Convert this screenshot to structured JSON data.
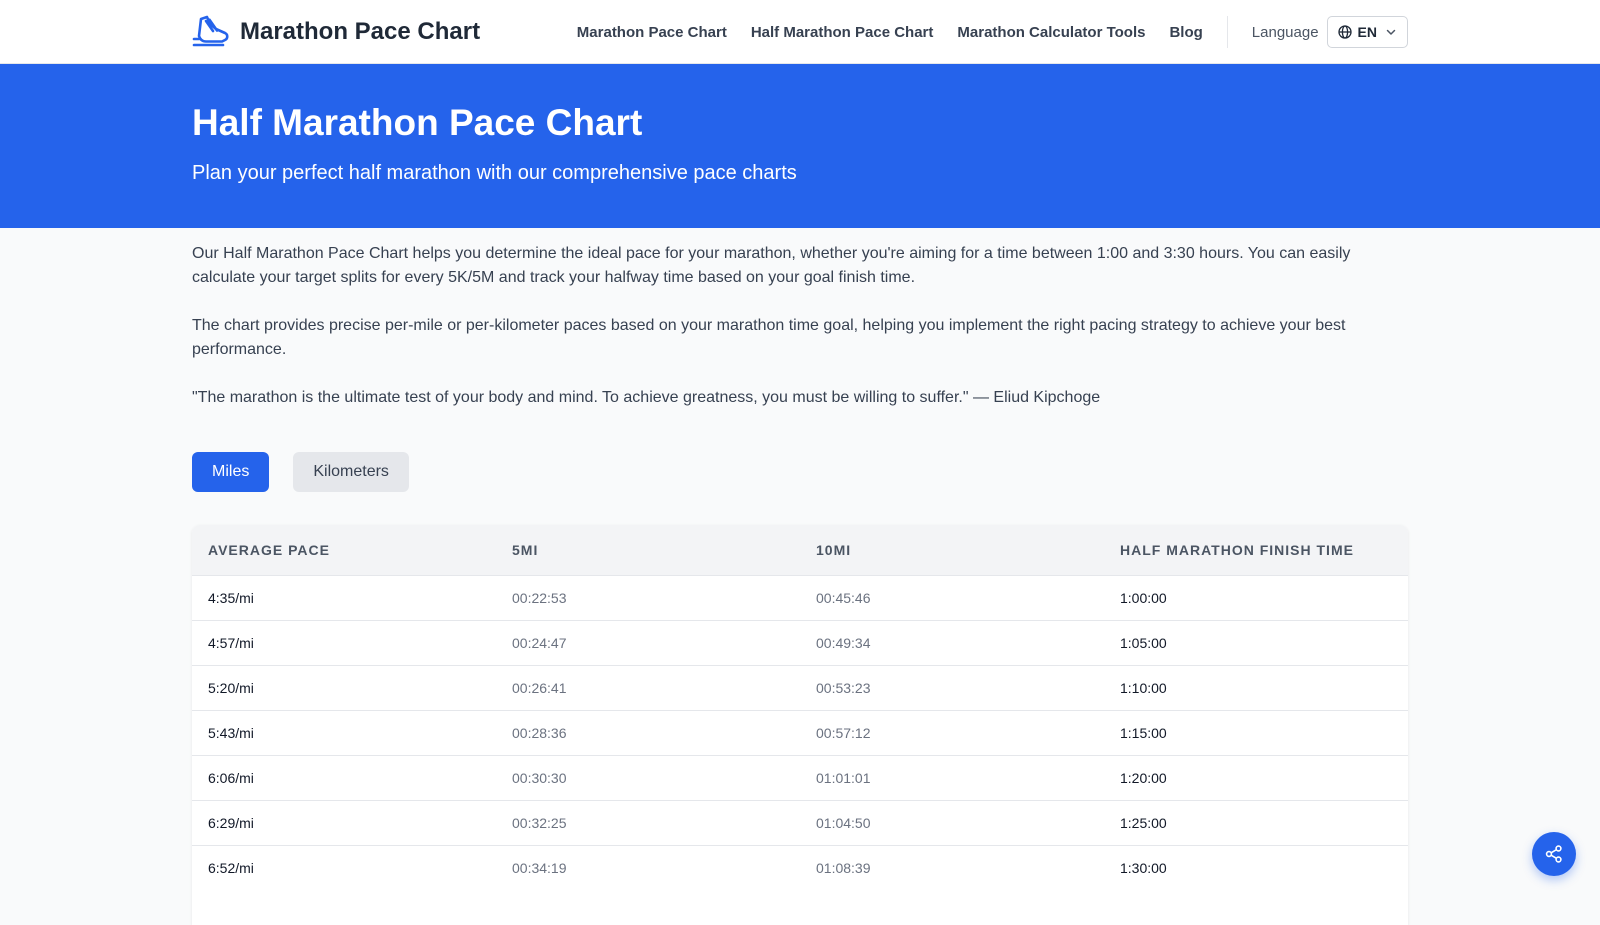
{
  "brand": {
    "name": "Marathon Pace Chart",
    "logo_icon": "running-shoe-icon",
    "accent_color": "#2563eb"
  },
  "nav": {
    "links": [
      {
        "label": "Marathon Pace Chart"
      },
      {
        "label": "Half Marathon Pace Chart"
      },
      {
        "label": "Marathon Calculator Tools"
      },
      {
        "label": "Blog"
      }
    ],
    "language_label": "Language",
    "language_code": "EN",
    "language_icon": "globe-icon",
    "language_chevron_icon": "chevron-down-icon"
  },
  "hero": {
    "title": "Half Marathon Pace Chart",
    "subtitle": "Plan your perfect half marathon with our comprehensive pace charts"
  },
  "intro": {
    "paragraphs": [
      "Our Half Marathon Pace Chart helps you determine the ideal pace for your marathon, whether you're aiming for a time between 1:00 and 3:30 hours. You can easily calculate your target splits for every 5K/5M and track your halfway time based on your goal finish time.",
      "The chart provides precise per-mile or per-kilometer paces based on your marathon time goal, helping you implement the right pacing strategy to achieve your best performance.",
      "\"The marathon is the ultimate test of your body and mind. To achieve greatness, you must be willing to suffer.\" — Eliud Kipchoge"
    ]
  },
  "units": {
    "options": [
      "Miles",
      "Kilometers"
    ],
    "selected": "Miles"
  },
  "table": {
    "headers": [
      "AVERAGE PACE",
      "5MI",
      "10MI",
      "HALF MARATHON FINISH TIME"
    ],
    "rows": [
      {
        "pace": "4:35/mi",
        "split_5": "00:22:53",
        "split_10": "00:45:46",
        "finish": "1:00:00"
      },
      {
        "pace": "4:57/mi",
        "split_5": "00:24:47",
        "split_10": "00:49:34",
        "finish": "1:05:00"
      },
      {
        "pace": "5:20/mi",
        "split_5": "00:26:41",
        "split_10": "00:53:23",
        "finish": "1:10:00"
      },
      {
        "pace": "5:43/mi",
        "split_5": "00:28:36",
        "split_10": "00:57:12",
        "finish": "1:15:00"
      },
      {
        "pace": "6:06/mi",
        "split_5": "00:30:30",
        "split_10": "01:01:01",
        "finish": "1:20:00"
      },
      {
        "pace": "6:29/mi",
        "split_5": "00:32:25",
        "split_10": "01:04:50",
        "finish": "1:25:00"
      },
      {
        "pace": "6:52/mi",
        "split_5": "00:34:19",
        "split_10": "01:08:39",
        "finish": "1:30:00"
      }
    ]
  },
  "share_button": {
    "icon": "share-icon"
  }
}
